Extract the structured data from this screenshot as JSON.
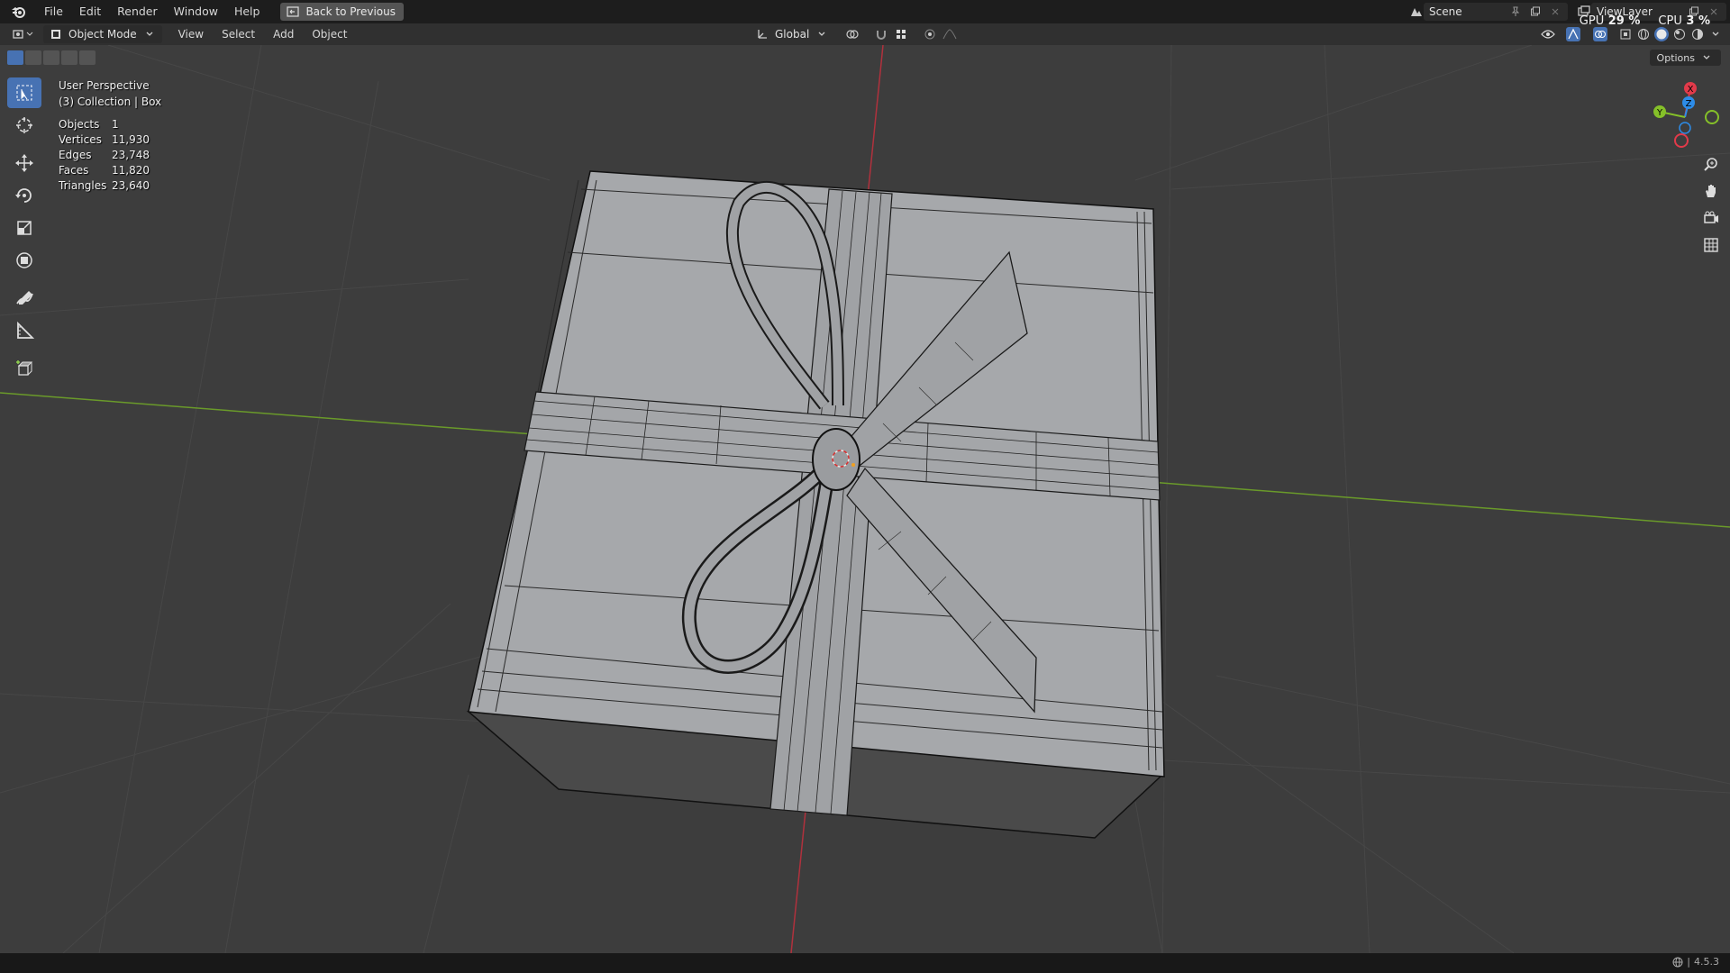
{
  "topbar": {
    "menus": [
      "File",
      "Edit",
      "Render",
      "Window",
      "Help"
    ],
    "back_label": "Back to Previous",
    "scene_name": "Scene",
    "viewlayer_name": "ViewLayer",
    "gpu_label": "GPU",
    "gpu_value": "29 %",
    "cpu_label": "CPU",
    "cpu_value": "3 %"
  },
  "viewport_header": {
    "mode": "Object Mode",
    "menus": [
      "View",
      "Select",
      "Add",
      "Object"
    ],
    "orientation": "Global",
    "options_label": "Options"
  },
  "overlay": {
    "view_name": "User Perspective",
    "collection": "(3) Collection | Box",
    "stats": [
      {
        "label": "Objects",
        "value": "1"
      },
      {
        "label": "Vertices",
        "value": "11,930"
      },
      {
        "label": "Edges",
        "value": "23,748"
      },
      {
        "label": "Faces",
        "value": "11,820"
      },
      {
        "label": "Triangles",
        "value": "23,640"
      }
    ]
  },
  "gizmo": {
    "x": "X",
    "y": "Y",
    "z": "Z"
  },
  "status": {
    "version": "4.5.3"
  },
  "colors": {
    "viewport_bg": "#3d3d3d",
    "accent": "#4772b3",
    "x_axis": "#e23a4a",
    "y_axis": "#85c029",
    "z_axis": "#2d8ce8"
  },
  "icons": [
    "blender-logo-icon",
    "editor-type-icon",
    "select-box-icon",
    "cursor-icon",
    "move-icon",
    "rotate-icon",
    "scale-icon",
    "transform-icon",
    "annotate-icon",
    "measure-icon",
    "add-cube-icon",
    "zoom-icon",
    "hand-icon",
    "camera-icon",
    "grid-icon"
  ]
}
